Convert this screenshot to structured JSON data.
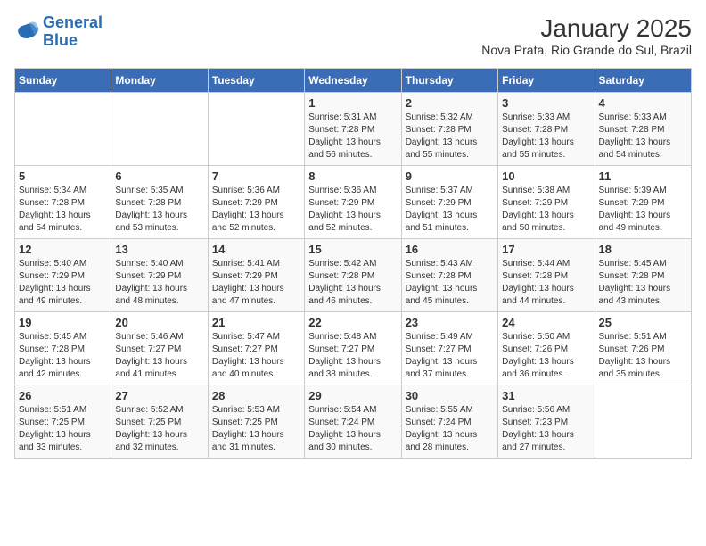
{
  "logo": {
    "line1": "General",
    "line2": "Blue"
  },
  "title": "January 2025",
  "subtitle": "Nova Prata, Rio Grande do Sul, Brazil",
  "days_of_week": [
    "Sunday",
    "Monday",
    "Tuesday",
    "Wednesday",
    "Thursday",
    "Friday",
    "Saturday"
  ],
  "weeks": [
    [
      {
        "day": "",
        "sunrise": "",
        "sunset": "",
        "daylight": ""
      },
      {
        "day": "",
        "sunrise": "",
        "sunset": "",
        "daylight": ""
      },
      {
        "day": "",
        "sunrise": "",
        "sunset": "",
        "daylight": ""
      },
      {
        "day": "1",
        "sunrise": "Sunrise: 5:31 AM",
        "sunset": "Sunset: 7:28 PM",
        "daylight": "Daylight: 13 hours and 56 minutes."
      },
      {
        "day": "2",
        "sunrise": "Sunrise: 5:32 AM",
        "sunset": "Sunset: 7:28 PM",
        "daylight": "Daylight: 13 hours and 55 minutes."
      },
      {
        "day": "3",
        "sunrise": "Sunrise: 5:33 AM",
        "sunset": "Sunset: 7:28 PM",
        "daylight": "Daylight: 13 hours and 55 minutes."
      },
      {
        "day": "4",
        "sunrise": "Sunrise: 5:33 AM",
        "sunset": "Sunset: 7:28 PM",
        "daylight": "Daylight: 13 hours and 54 minutes."
      }
    ],
    [
      {
        "day": "5",
        "sunrise": "Sunrise: 5:34 AM",
        "sunset": "Sunset: 7:28 PM",
        "daylight": "Daylight: 13 hours and 54 minutes."
      },
      {
        "day": "6",
        "sunrise": "Sunrise: 5:35 AM",
        "sunset": "Sunset: 7:28 PM",
        "daylight": "Daylight: 13 hours and 53 minutes."
      },
      {
        "day": "7",
        "sunrise": "Sunrise: 5:36 AM",
        "sunset": "Sunset: 7:29 PM",
        "daylight": "Daylight: 13 hours and 52 minutes."
      },
      {
        "day": "8",
        "sunrise": "Sunrise: 5:36 AM",
        "sunset": "Sunset: 7:29 PM",
        "daylight": "Daylight: 13 hours and 52 minutes."
      },
      {
        "day": "9",
        "sunrise": "Sunrise: 5:37 AM",
        "sunset": "Sunset: 7:29 PM",
        "daylight": "Daylight: 13 hours and 51 minutes."
      },
      {
        "day": "10",
        "sunrise": "Sunrise: 5:38 AM",
        "sunset": "Sunset: 7:29 PM",
        "daylight": "Daylight: 13 hours and 50 minutes."
      },
      {
        "day": "11",
        "sunrise": "Sunrise: 5:39 AM",
        "sunset": "Sunset: 7:29 PM",
        "daylight": "Daylight: 13 hours and 49 minutes."
      }
    ],
    [
      {
        "day": "12",
        "sunrise": "Sunrise: 5:40 AM",
        "sunset": "Sunset: 7:29 PM",
        "daylight": "Daylight: 13 hours and 49 minutes."
      },
      {
        "day": "13",
        "sunrise": "Sunrise: 5:40 AM",
        "sunset": "Sunset: 7:29 PM",
        "daylight": "Daylight: 13 hours and 48 minutes."
      },
      {
        "day": "14",
        "sunrise": "Sunrise: 5:41 AM",
        "sunset": "Sunset: 7:29 PM",
        "daylight": "Daylight: 13 hours and 47 minutes."
      },
      {
        "day": "15",
        "sunrise": "Sunrise: 5:42 AM",
        "sunset": "Sunset: 7:28 PM",
        "daylight": "Daylight: 13 hours and 46 minutes."
      },
      {
        "day": "16",
        "sunrise": "Sunrise: 5:43 AM",
        "sunset": "Sunset: 7:28 PM",
        "daylight": "Daylight: 13 hours and 45 minutes."
      },
      {
        "day": "17",
        "sunrise": "Sunrise: 5:44 AM",
        "sunset": "Sunset: 7:28 PM",
        "daylight": "Daylight: 13 hours and 44 minutes."
      },
      {
        "day": "18",
        "sunrise": "Sunrise: 5:45 AM",
        "sunset": "Sunset: 7:28 PM",
        "daylight": "Daylight: 13 hours and 43 minutes."
      }
    ],
    [
      {
        "day": "19",
        "sunrise": "Sunrise: 5:45 AM",
        "sunset": "Sunset: 7:28 PM",
        "daylight": "Daylight: 13 hours and 42 minutes."
      },
      {
        "day": "20",
        "sunrise": "Sunrise: 5:46 AM",
        "sunset": "Sunset: 7:27 PM",
        "daylight": "Daylight: 13 hours and 41 minutes."
      },
      {
        "day": "21",
        "sunrise": "Sunrise: 5:47 AM",
        "sunset": "Sunset: 7:27 PM",
        "daylight": "Daylight: 13 hours and 40 minutes."
      },
      {
        "day": "22",
        "sunrise": "Sunrise: 5:48 AM",
        "sunset": "Sunset: 7:27 PM",
        "daylight": "Daylight: 13 hours and 38 minutes."
      },
      {
        "day": "23",
        "sunrise": "Sunrise: 5:49 AM",
        "sunset": "Sunset: 7:27 PM",
        "daylight": "Daylight: 13 hours and 37 minutes."
      },
      {
        "day": "24",
        "sunrise": "Sunrise: 5:50 AM",
        "sunset": "Sunset: 7:26 PM",
        "daylight": "Daylight: 13 hours and 36 minutes."
      },
      {
        "day": "25",
        "sunrise": "Sunrise: 5:51 AM",
        "sunset": "Sunset: 7:26 PM",
        "daylight": "Daylight: 13 hours and 35 minutes."
      }
    ],
    [
      {
        "day": "26",
        "sunrise": "Sunrise: 5:51 AM",
        "sunset": "Sunset: 7:25 PM",
        "daylight": "Daylight: 13 hours and 33 minutes."
      },
      {
        "day": "27",
        "sunrise": "Sunrise: 5:52 AM",
        "sunset": "Sunset: 7:25 PM",
        "daylight": "Daylight: 13 hours and 32 minutes."
      },
      {
        "day": "28",
        "sunrise": "Sunrise: 5:53 AM",
        "sunset": "Sunset: 7:25 PM",
        "daylight": "Daylight: 13 hours and 31 minutes."
      },
      {
        "day": "29",
        "sunrise": "Sunrise: 5:54 AM",
        "sunset": "Sunset: 7:24 PM",
        "daylight": "Daylight: 13 hours and 30 minutes."
      },
      {
        "day": "30",
        "sunrise": "Sunrise: 5:55 AM",
        "sunset": "Sunset: 7:24 PM",
        "daylight": "Daylight: 13 hours and 28 minutes."
      },
      {
        "day": "31",
        "sunrise": "Sunrise: 5:56 AM",
        "sunset": "Sunset: 7:23 PM",
        "daylight": "Daylight: 13 hours and 27 minutes."
      },
      {
        "day": "",
        "sunrise": "",
        "sunset": "",
        "daylight": ""
      }
    ]
  ]
}
